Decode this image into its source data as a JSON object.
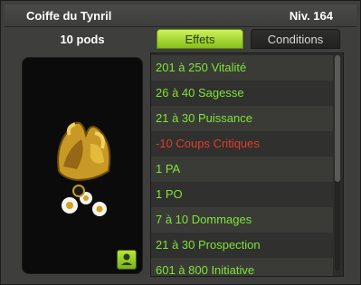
{
  "header": {
    "title": "Coiffe du Tynril",
    "level": "Niv. 164"
  },
  "pods": "10 pods",
  "tabs": [
    {
      "label": "Effets",
      "active": true
    },
    {
      "label": "Conditions",
      "active": false
    }
  ],
  "effects": [
    {
      "text": "201 à 250 Vitalité",
      "color": "#7fe23a"
    },
    {
      "text": "26 à 40 Sagesse",
      "color": "#7fe23a"
    },
    {
      "text": "21 à 30 Puissance",
      "color": "#7fe23a"
    },
    {
      "text": "-10 Coups Critiques",
      "color": "#e23a30"
    },
    {
      "text": "1 PA",
      "color": "#7fe23a"
    },
    {
      "text": "1 PO",
      "color": "#7fe23a"
    },
    {
      "text": "7 à 10 Dommages",
      "color": "#7fe23a"
    },
    {
      "text": "21 à 30 Prospection",
      "color": "#7fe23a"
    },
    {
      "text": "601 à 800 Initiative",
      "color": "#7fe23a"
    }
  ],
  "icons": {
    "item": "tynril-hat-icon",
    "usable": "bust-icon"
  }
}
